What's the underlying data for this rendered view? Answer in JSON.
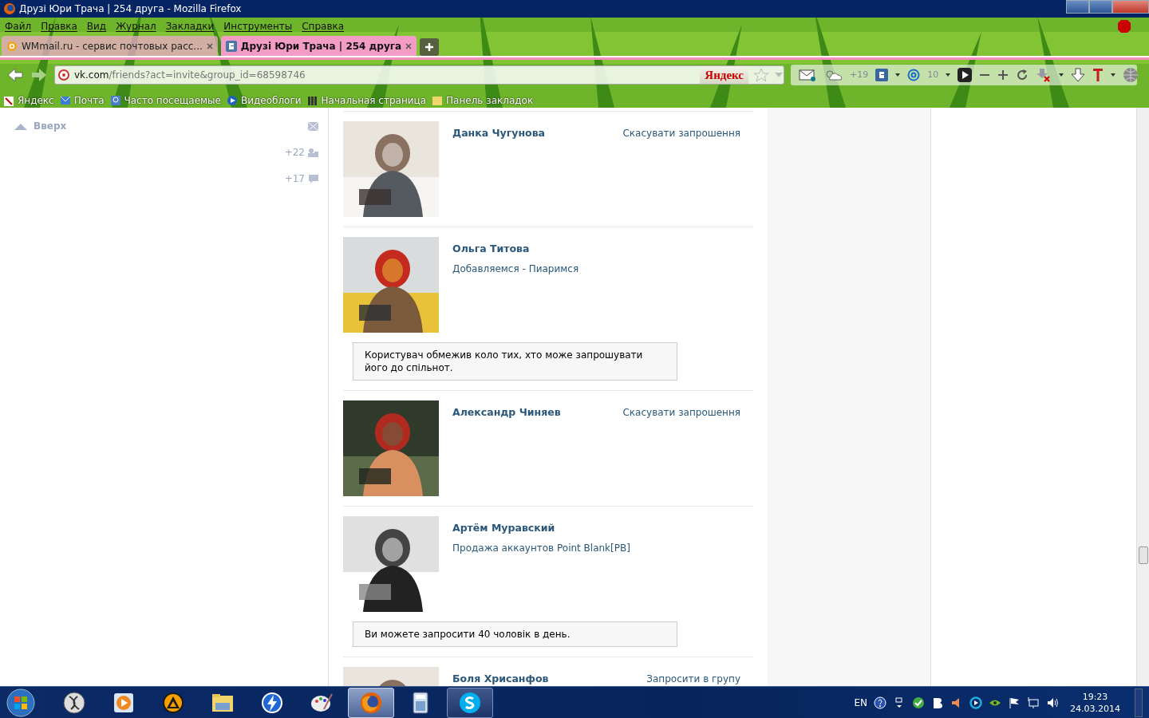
{
  "window": {
    "title": "Друзі Юри Трача | 254 друга - Mozilla Firefox"
  },
  "menu": [
    "Файл",
    "Правка",
    "Вид",
    "Журнал",
    "Закладки",
    "Инструменты",
    "Справка"
  ],
  "tabs": [
    {
      "label": "WMmail.ru - сервис почтовых расс...",
      "selected": false
    },
    {
      "label": "Друзі Юри Трача | 254 друга",
      "selected": true
    }
  ],
  "address": {
    "host": "vk.com",
    "path": "/friends?act=invite&group_id=68598746"
  },
  "search_engine": "Яндекс",
  "toolbar": {
    "weather": "+19",
    "mail_count": "10"
  },
  "bookmarks": [
    "Яндекс",
    "Почта",
    "Часто посещаемые",
    "Видеоблоги",
    "Начальная страница",
    "Панель закладок"
  ],
  "sidebar": {
    "up": "Вверх",
    "counters": [
      "+22",
      "+17"
    ]
  },
  "friends": [
    {
      "name": "Данка Чугунова",
      "action": "Скасувати запрошення"
    },
    {
      "name": "Ольга Титова",
      "status": "Добавляемся - Пиаримся",
      "notice": "Користувач обмежив коло тих, хто може запрошувати його до спільнот."
    },
    {
      "name": "Александр Чиняев",
      "action": "Скасувати запрошення"
    },
    {
      "name": "Артём Муравский",
      "status": "Продажа аккаунтов Point Blank[PB]",
      "notice": "Ви можете запросити 40 чоловік в день."
    },
    {
      "name": "Боля Хрисанфов",
      "action": "Запросити в групу"
    }
  ],
  "taskbar": {
    "apps": [
      {
        "kind": "sphere",
        "selected": false
      },
      {
        "kind": "player",
        "selected": false
      },
      {
        "kind": "aimp",
        "selected": false
      },
      {
        "kind": "folder",
        "selected": false
      },
      {
        "kind": "bolt",
        "selected": false
      },
      {
        "kind": "paint",
        "selected": false
      },
      {
        "kind": "firefox",
        "selected": true
      },
      {
        "kind": "calculator",
        "selected": false
      },
      {
        "kind": "skype",
        "selected": false
      }
    ],
    "language": "EN",
    "time": "19:23",
    "date": "24.03.2014"
  }
}
